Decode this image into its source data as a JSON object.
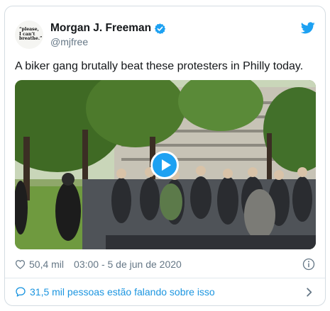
{
  "author": {
    "display_name": "Morgan J. Freeman",
    "handle": "@mjfree",
    "avatar_text": [
      "“please,",
      "I can’t",
      "breathe.”"
    ],
    "verified": true
  },
  "tweet": {
    "text": "A biker gang brutally beat these protesters in Philly today."
  },
  "media": {
    "type": "video",
    "play_icon": "play-icon"
  },
  "meta": {
    "likes": "50,4 mil",
    "timestamp": "03:00 - 5 de jun de 2020"
  },
  "conversation": {
    "label": "31,5 mil pessoas estão falando sobre isso"
  },
  "colors": {
    "accent": "#1da1f2",
    "link": "#1b95e0",
    "secondary_text": "#657786",
    "border": "#d4dce2"
  },
  "icons": [
    "verified-badge-icon",
    "twitter-bird-icon",
    "play-icon",
    "heart-icon",
    "info-icon",
    "speech-bubble-icon",
    "chevron-right-icon"
  ]
}
